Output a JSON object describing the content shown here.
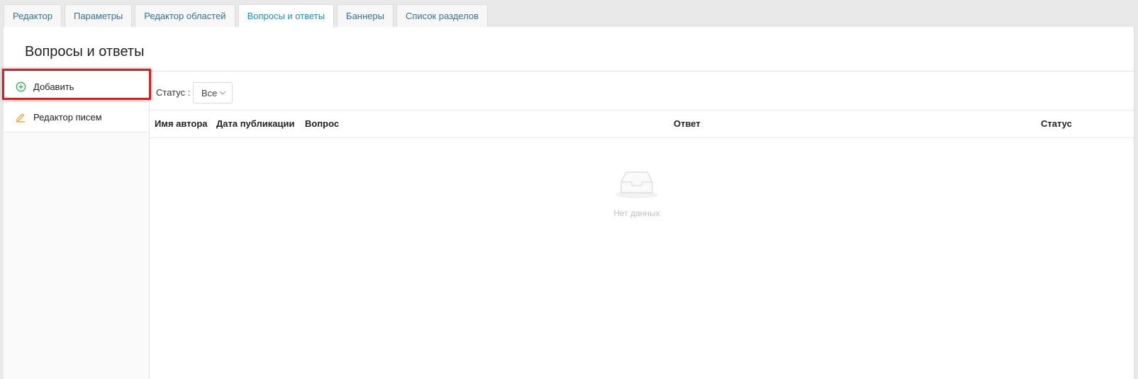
{
  "tabs": [
    {
      "label": "Редактор",
      "active": false
    },
    {
      "label": "Параметры",
      "active": false
    },
    {
      "label": "Редактор областей",
      "active": false
    },
    {
      "label": "Вопросы и ответы",
      "active": true
    },
    {
      "label": "Баннеры",
      "active": false
    },
    {
      "label": "Список разделов",
      "active": false
    }
  ],
  "page": {
    "title": "Вопросы и ответы"
  },
  "sidebar": {
    "items": [
      {
        "label": "Добавить",
        "icon": "plus-circle-icon",
        "icon_color": "#3aa757",
        "highlighted": true
      },
      {
        "label": "Редактор писем",
        "icon": "pencil-icon",
        "icon_color": "#e8a33a"
      }
    ]
  },
  "filter": {
    "label": "Статус :",
    "value": "Все"
  },
  "table": {
    "columns": [
      "Имя автора",
      "Дата публикации",
      "Вопрос",
      "Ответ",
      "Статус"
    ],
    "rows": [],
    "empty_text": "Нет данных"
  },
  "colors": {
    "accent": "#2a8ab7",
    "highlight": "#c62828"
  }
}
